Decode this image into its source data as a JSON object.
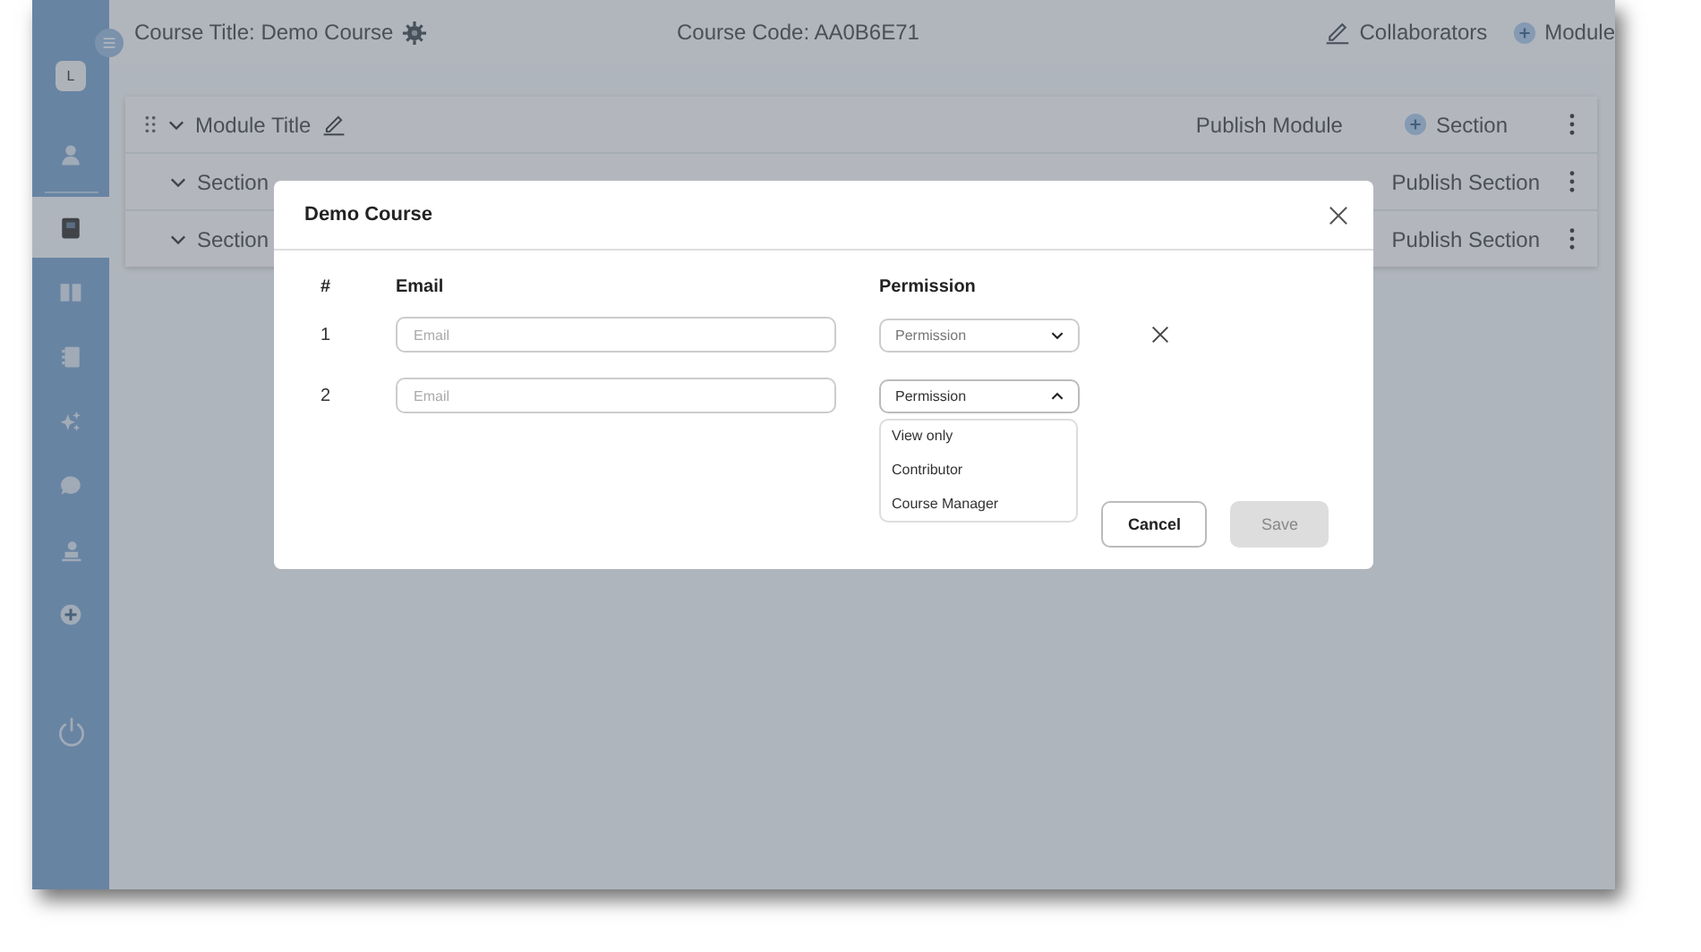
{
  "header": {
    "course_title": "Course Title: Demo Course",
    "course_code": "Course Code: AA0B6E71",
    "collaborators": "Collaborators",
    "add_module": "Module"
  },
  "sidebar": {
    "avatar": "L",
    "items": [
      {
        "selected": false
      },
      {
        "selected": true
      },
      {
        "selected": false
      },
      {
        "selected": false
      },
      {
        "selected": false
      },
      {
        "selected": false
      },
      {
        "selected": false
      },
      {
        "selected": false
      }
    ]
  },
  "module": {
    "title": "Module Title",
    "publish": "Publish Module",
    "add_section": "Section",
    "sections": [
      {
        "title": "Section",
        "publish": "Publish Section"
      },
      {
        "title": "Section",
        "publish": "Publish Section"
      }
    ]
  },
  "dialog": {
    "title": "Demo Course",
    "columns": [
      "#",
      "Email",
      "Permission"
    ],
    "rows": [
      {
        "number": "1",
        "email_placeholder": "Email",
        "permission_placeholder": "Permission",
        "expanded": false,
        "removable": true
      },
      {
        "number": "2",
        "email_placeholder": "Email",
        "permission_placeholder": "Permission",
        "expanded": true,
        "removable": false,
        "options": [
          "View only",
          "Contributor",
          "Course Manager"
        ]
      }
    ],
    "buttons": [
      {
        "label": "Cancel",
        "disabled": false
      },
      {
        "label": "Save",
        "disabled": true
      }
    ]
  }
}
